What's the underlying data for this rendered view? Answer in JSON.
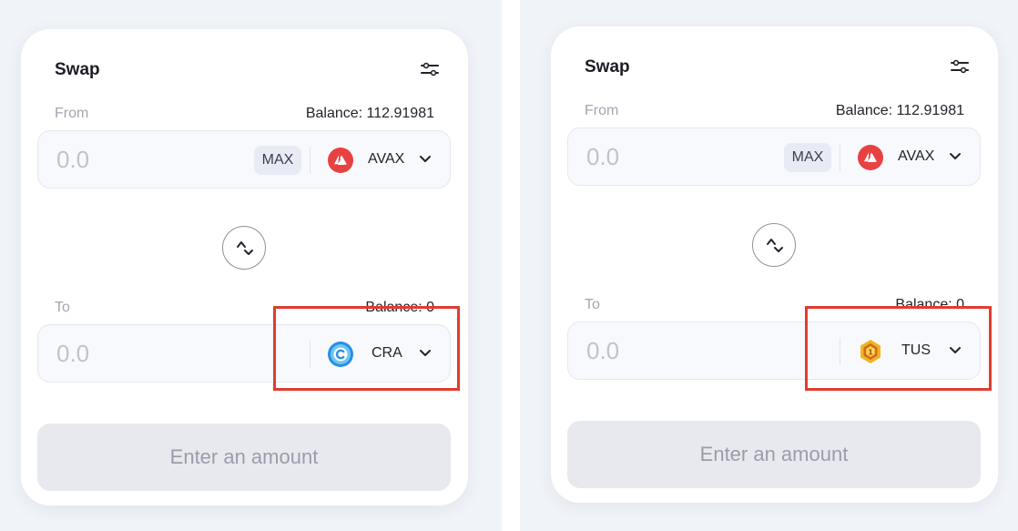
{
  "screens": [
    {
      "title": "Swap",
      "from": {
        "label": "From",
        "balance": "Balance: 112.91981",
        "amount_placeholder": "0.0",
        "max_label": "MAX",
        "token": "AVAX"
      },
      "to": {
        "label": "To",
        "balance": "Balance: 0",
        "amount_placeholder": "0.0",
        "token": "CRA"
      },
      "action_label": "Enter an amount"
    },
    {
      "title": "Swap",
      "from": {
        "label": "From",
        "balance": "Balance: 112.91981",
        "amount_placeholder": "0.0",
        "max_label": "MAX",
        "token": "AVAX"
      },
      "to": {
        "label": "To",
        "balance": "Balance: 0",
        "amount_placeholder": "0.0",
        "token": "TUS"
      },
      "action_label": "Enter an amount"
    }
  ],
  "icons": {
    "settings": "sliders-icon",
    "swap": "swap-direction-icon",
    "avax": "avax-token-icon",
    "cra": "cra-token-icon",
    "tus": "tus-token-icon",
    "chevron": "chevron-down-icon"
  },
  "colors": {
    "background": "#f0f3f8",
    "card": "#ffffff",
    "avax_red": "#e84142",
    "cra_blue": "#2b8fe0",
    "tus_gold": "#f0b323",
    "highlight": "#e03c31",
    "disabled_button": "#e8e9ee"
  }
}
